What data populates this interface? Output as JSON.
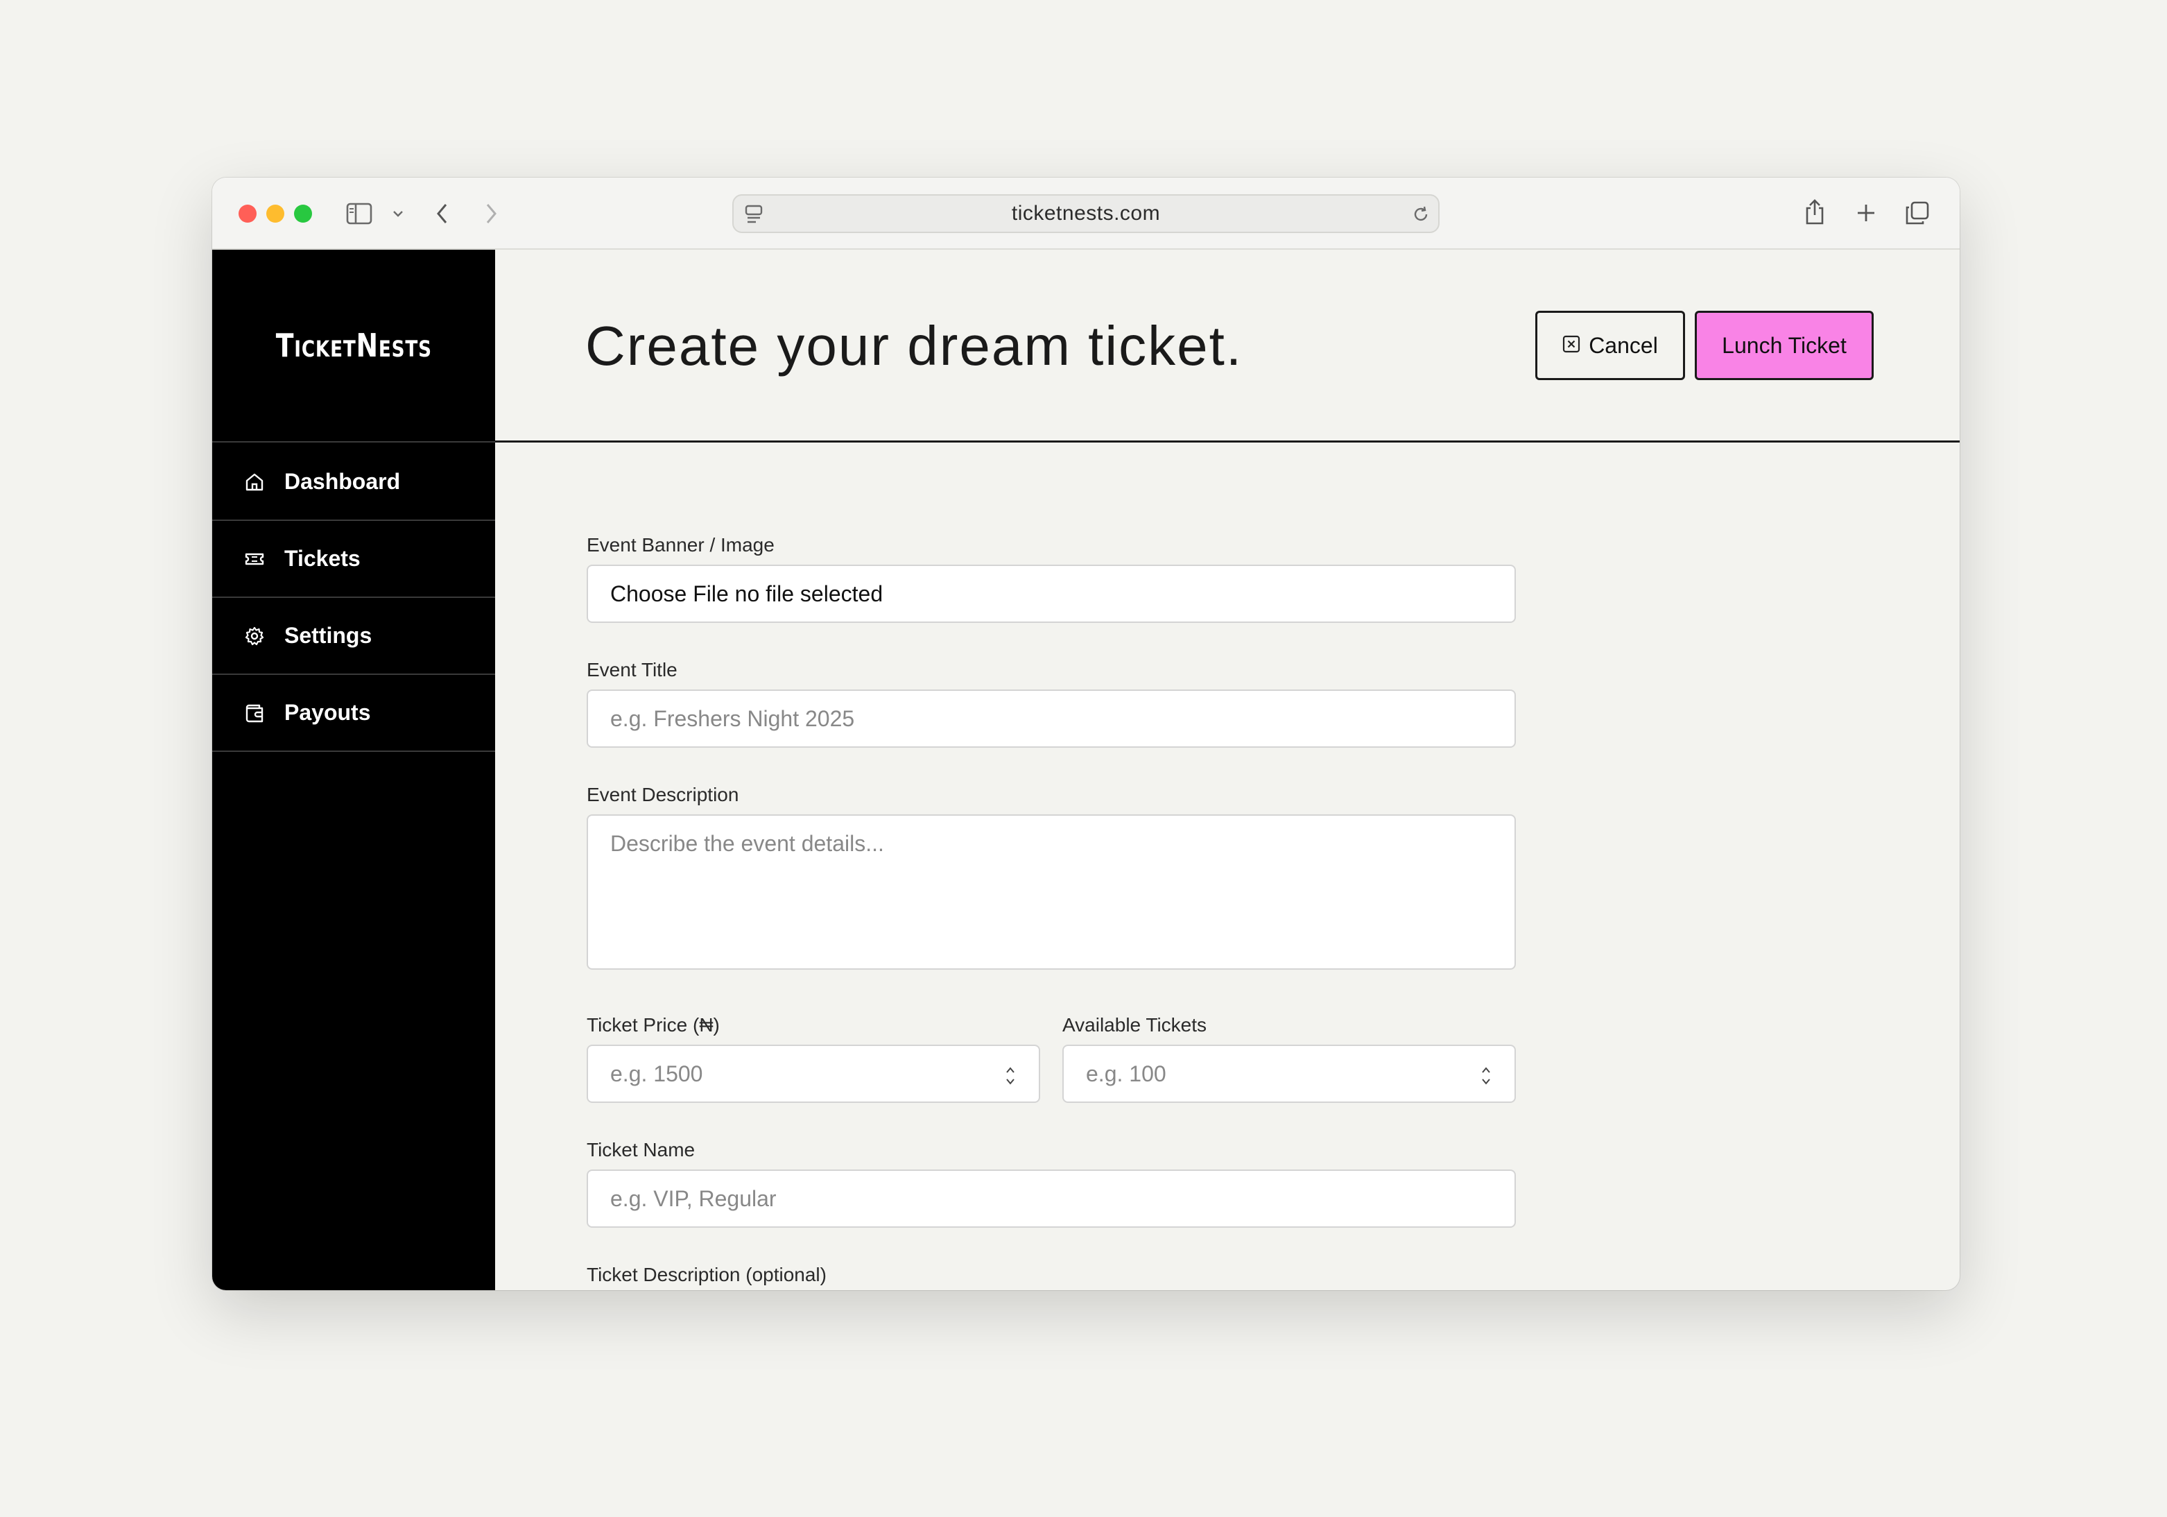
{
  "browser": {
    "url": "ticketnests.com",
    "colors": {
      "close": "#ff5f57",
      "minimize": "#febc2e",
      "zoom": "#28c840"
    }
  },
  "sidebar": {
    "logo": "TicketNests",
    "items": [
      {
        "label": "Dashboard",
        "icon": "home-icon"
      },
      {
        "label": "Tickets",
        "icon": "ticket-icon"
      },
      {
        "label": "Settings",
        "icon": "gear-icon"
      },
      {
        "label": "Payouts",
        "icon": "wallet-icon"
      }
    ]
  },
  "header": {
    "title": "Create your dream ticket.",
    "cancel_label": "Cancel",
    "launch_label": "Lunch Ticket",
    "launch_color": "#f983e6"
  },
  "form": {
    "banner": {
      "label": "Event Banner / Image",
      "value": "Choose File no file selected"
    },
    "title": {
      "label": "Event Title",
      "placeholder": "e.g. Freshers Night 2025"
    },
    "description": {
      "label": "Event Description",
      "placeholder": "Describe the event details..."
    },
    "price": {
      "label": "Ticket Price (₦)",
      "placeholder": "e.g. 1500"
    },
    "available": {
      "label": "Available Tickets",
      "placeholder": "e.g. 100"
    },
    "ticket_name": {
      "label": "Ticket Name",
      "placeholder": "e.g. VIP, Regular"
    },
    "ticket_description": {
      "label": "Ticket Description (optional)"
    }
  }
}
